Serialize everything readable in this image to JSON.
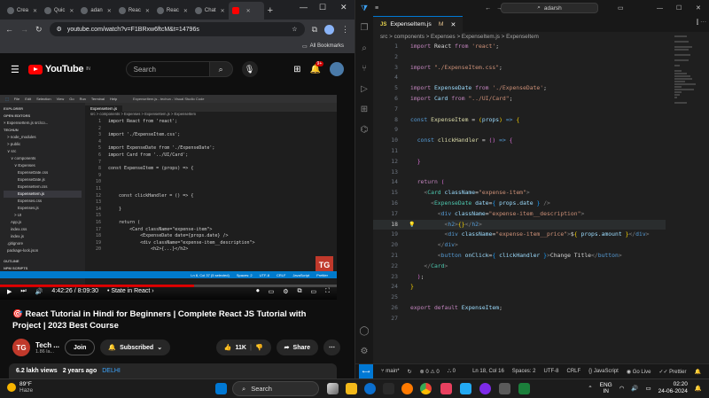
{
  "chrome": {
    "tabs": [
      {
        "label": "Crea"
      },
      {
        "label": "Quic"
      },
      {
        "label": "adan"
      },
      {
        "label": "Reac"
      },
      {
        "label": "Reac"
      },
      {
        "label": "Chat"
      },
      {
        "label": ""
      }
    ],
    "url": "youtube.com/watch?v=F1BRxw6ftcM&t=14796s",
    "bookmarks_label": "All Bookmarks"
  },
  "youtube": {
    "region": "IN",
    "search_placeholder": "Search",
    "notifications": "9+",
    "video_title": "🎯 React Tutorial in Hindi for Beginners | Complete React JS Tutorial with Project | 2023 Best Course",
    "time_current": "4:42:26",
    "time_total": "8:09:30",
    "chapter": "State in React",
    "progress": 0.577,
    "channel_initials": "TG",
    "channel_name": "Tech ...",
    "channel_subs": "1.86 la...",
    "join_label": "Join",
    "subscribed_label": "Subscribed",
    "likes": "11K",
    "share_label": "Share",
    "views": "6.2 lakh views",
    "age": "2 years ago",
    "location": "DELHI",
    "watermark": "TG",
    "video": {
      "menu": [
        "File",
        "Edit",
        "Selection",
        "View",
        "Go",
        "Run",
        "Terminal",
        "Help"
      ],
      "window_title": "ExpenseItem.js - techun - Visual Studio Code",
      "tab": "ExpenseItem.js",
      "breadcrumb": "src > components > Expenses > ExpenseItem.js > ExpenseItem",
      "explorer": [
        "EXPLORER",
        "OPEN EDITORS",
        "× ExpenseItem.js src\\co...",
        "TECHUN",
        "> node_modules",
        "> public",
        "∨ src",
        "∨ components",
        "∨ Expenses",
        "ExpenseDate.css",
        "ExpenseDate.js",
        "ExpenseItem.css",
        "ExpenseItem.js",
        "Expenses.css",
        "Expenses.js",
        "> UI",
        "App.js",
        "index.css",
        "index.js",
        ".gitignore",
        "package-lock.json"
      ],
      "explorer_bottom": [
        "OUTLINE",
        "NPM SCRIPTS"
      ],
      "lines": [
        {
          "n": "1",
          "t": "import React from 'react';"
        },
        {
          "n": "2",
          "t": ""
        },
        {
          "n": "3",
          "t": "import './ExpenseItem.css';"
        },
        {
          "n": "4",
          "t": ""
        },
        {
          "n": "5",
          "t": "import ExpenseDate from './ExpenseDate';"
        },
        {
          "n": "6",
          "t": "import Card from '../UI/Card';"
        },
        {
          "n": "7",
          "t": ""
        },
        {
          "n": "8",
          "t": "const ExpenseItem = (props) => {"
        },
        {
          "n": "9",
          "t": ""
        },
        {
          "n": "10",
          "t": ""
        },
        {
          "n": "11",
          "t": ""
        },
        {
          "n": "12",
          "t": "    const clickHandler = () => {"
        },
        {
          "n": "13",
          "t": ""
        },
        {
          "n": "14",
          "t": "    }"
        },
        {
          "n": "15",
          "t": ""
        },
        {
          "n": "16",
          "t": "    return ("
        },
        {
          "n": "17",
          "t": "        <Card className=\"expense-item\">"
        },
        {
          "n": "18",
          "t": "            <ExpenseDate date={props.date} />"
        },
        {
          "n": "19",
          "t": "            <div className=\"expense-item__description\">"
        },
        {
          "n": "20",
          "t": "                <h2>{...}</h2>"
        }
      ],
      "status": [
        "Ln 8, Col 37 (5 selected)",
        "Spaces: 2",
        "UTF-8",
        "CRLF",
        "JavaScript",
        "Prettier"
      ]
    }
  },
  "vscode": {
    "search": "adarsh",
    "tab": "ExpenseItem.js",
    "tab_icon": "JS",
    "tab_modified": "M",
    "breadcrumb": "src > components > Expenses > ExpenseItem.js > ExpenseItem",
    "status": {
      "branch": "main*",
      "errors": "0",
      "warnings": "0",
      "ports": "0",
      "position": "Ln 18, Col 16",
      "spaces": "Spaces: 2",
      "encoding": "UTF-8",
      "eol": "CRLF",
      "language": "{} JavaScript",
      "golive": "Go Live",
      "prettier": "Prettier"
    }
  },
  "taskbar": {
    "temp": "89°F",
    "condition": "Haze",
    "search": "Search",
    "lang": "ENG",
    "region": "IN",
    "time": "02:20",
    "date": "24-06-2024"
  }
}
